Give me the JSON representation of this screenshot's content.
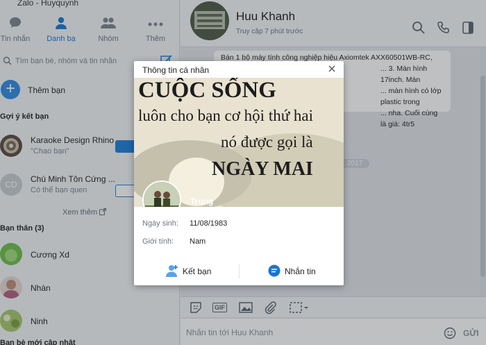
{
  "app": {
    "title": "Zalo - Huyquynh"
  },
  "nav": {
    "tabs": [
      {
        "label": "Tin nhắn",
        "icon": "chat-bubble-icon",
        "active": false
      },
      {
        "label": "Danh bạ",
        "icon": "contact-person-icon",
        "active": true
      },
      {
        "label": "Nhóm",
        "icon": "group-people-icon",
        "active": false
      },
      {
        "label": "Thêm",
        "icon": "more-dots-icon",
        "active": false
      }
    ]
  },
  "search": {
    "placeholder": "Tìm bạn bè, nhóm và tin nhắn"
  },
  "add_friend": {
    "label": "Thêm bạn"
  },
  "suggestions": {
    "title": "Gợi ý kết bạn",
    "items": [
      {
        "name": "Karaoke Design Rhino",
        "subtitle": "\"Chao bạn\""
      },
      {
        "name": "Chú Minh Tôn Cứng ...",
        "subtitle": "Có thể bạn quen",
        "initials": "CD"
      }
    ],
    "see_more": "Xem thêm"
  },
  "close_friends": {
    "title": "Bạn thân (3)",
    "items": [
      {
        "name": "Cương Xd"
      },
      {
        "name": "Nhàn"
      },
      {
        "name": "Ninh"
      }
    ]
  },
  "recent_section": {
    "title": "Bạn bè mới cập nhật"
  },
  "conversation": {
    "name": "Huu Khanh",
    "status": "Truy cập 7 phút trước",
    "message_lines": [
      "Bán 1 bộ máy tính công nghiệp hiệu Axiomtek AXX60501WB-RC,",
      "... 3. Màn hình 17inch. Màn",
      "... màn hình có lớp plastic trong",
      "... nha. Cuối cùng là giá: 4tr5"
    ],
    "date_separator": "2017",
    "composer_placeholder": "Nhắn tin tới Huu Khanh",
    "send_label": "GỬI"
  },
  "toolbar": {
    "gif_label": "GIF"
  },
  "profile": {
    "title": "Thông tin cá nhân",
    "name": "Trung",
    "cover_text": [
      "CUỘC SỐNG",
      "luôn cho bạn cơ hội thứ hai",
      "nó được gọi là",
      "NGÀY MAI"
    ],
    "fields": [
      {
        "label": "Ngày sinh:",
        "value": "11/08/1983"
      },
      {
        "label": "Giới tính:",
        "value": "Nam"
      }
    ],
    "buttons": {
      "add_friend": "Kết bạn",
      "message": "Nhắn tin"
    }
  },
  "colors": {
    "accent": "#1776d2",
    "header_bg": "#f4f6f8",
    "chat_bg": "#e2e6ea"
  }
}
